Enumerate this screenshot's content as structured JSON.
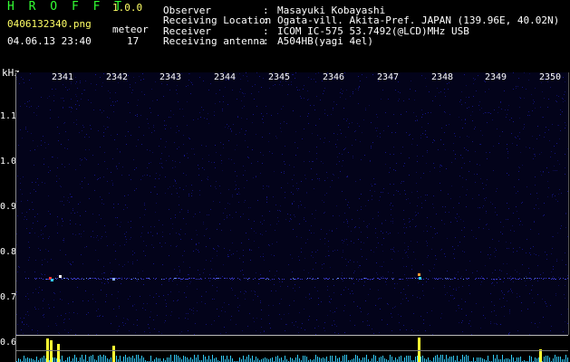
{
  "header": {
    "app_title": "H R O F F T",
    "app_version": "1.0.0",
    "filename": "0406132340.png",
    "timestamp": "04.06.13 23:40",
    "meteor_label": "meteor",
    "meteor_count": "17"
  },
  "info": {
    "keys": "Observer\nReceiving Location\nReceiver\nReceiving antenna",
    "separators": ":\n:\n:\n:",
    "values": "Masayuki Kobayashi\nOgata-vill. Akita-Pref. JAPAN (139.96E, 40.02N)\nICOM IC-575 53.7492(@LCD)MHz USB\nA504HB(yagi 4el)"
  },
  "axis": {
    "y_unit": "kHz",
    "y_ticks": [
      "1.1",
      "1.0",
      "0.9",
      "0.8",
      "0.7",
      "0.6"
    ],
    "x_ticks": [
      "2341",
      "2342",
      "2343",
      "2344",
      "2345",
      "2346",
      "2347",
      "2348",
      "2349",
      "2350"
    ]
  },
  "colors": {
    "background": "#000000",
    "noise": "#1a1aa0",
    "signal": "#ffff33",
    "histogram": "#33ccff",
    "text_green": "#33ff33",
    "text_yellow": "#ffff66"
  }
}
